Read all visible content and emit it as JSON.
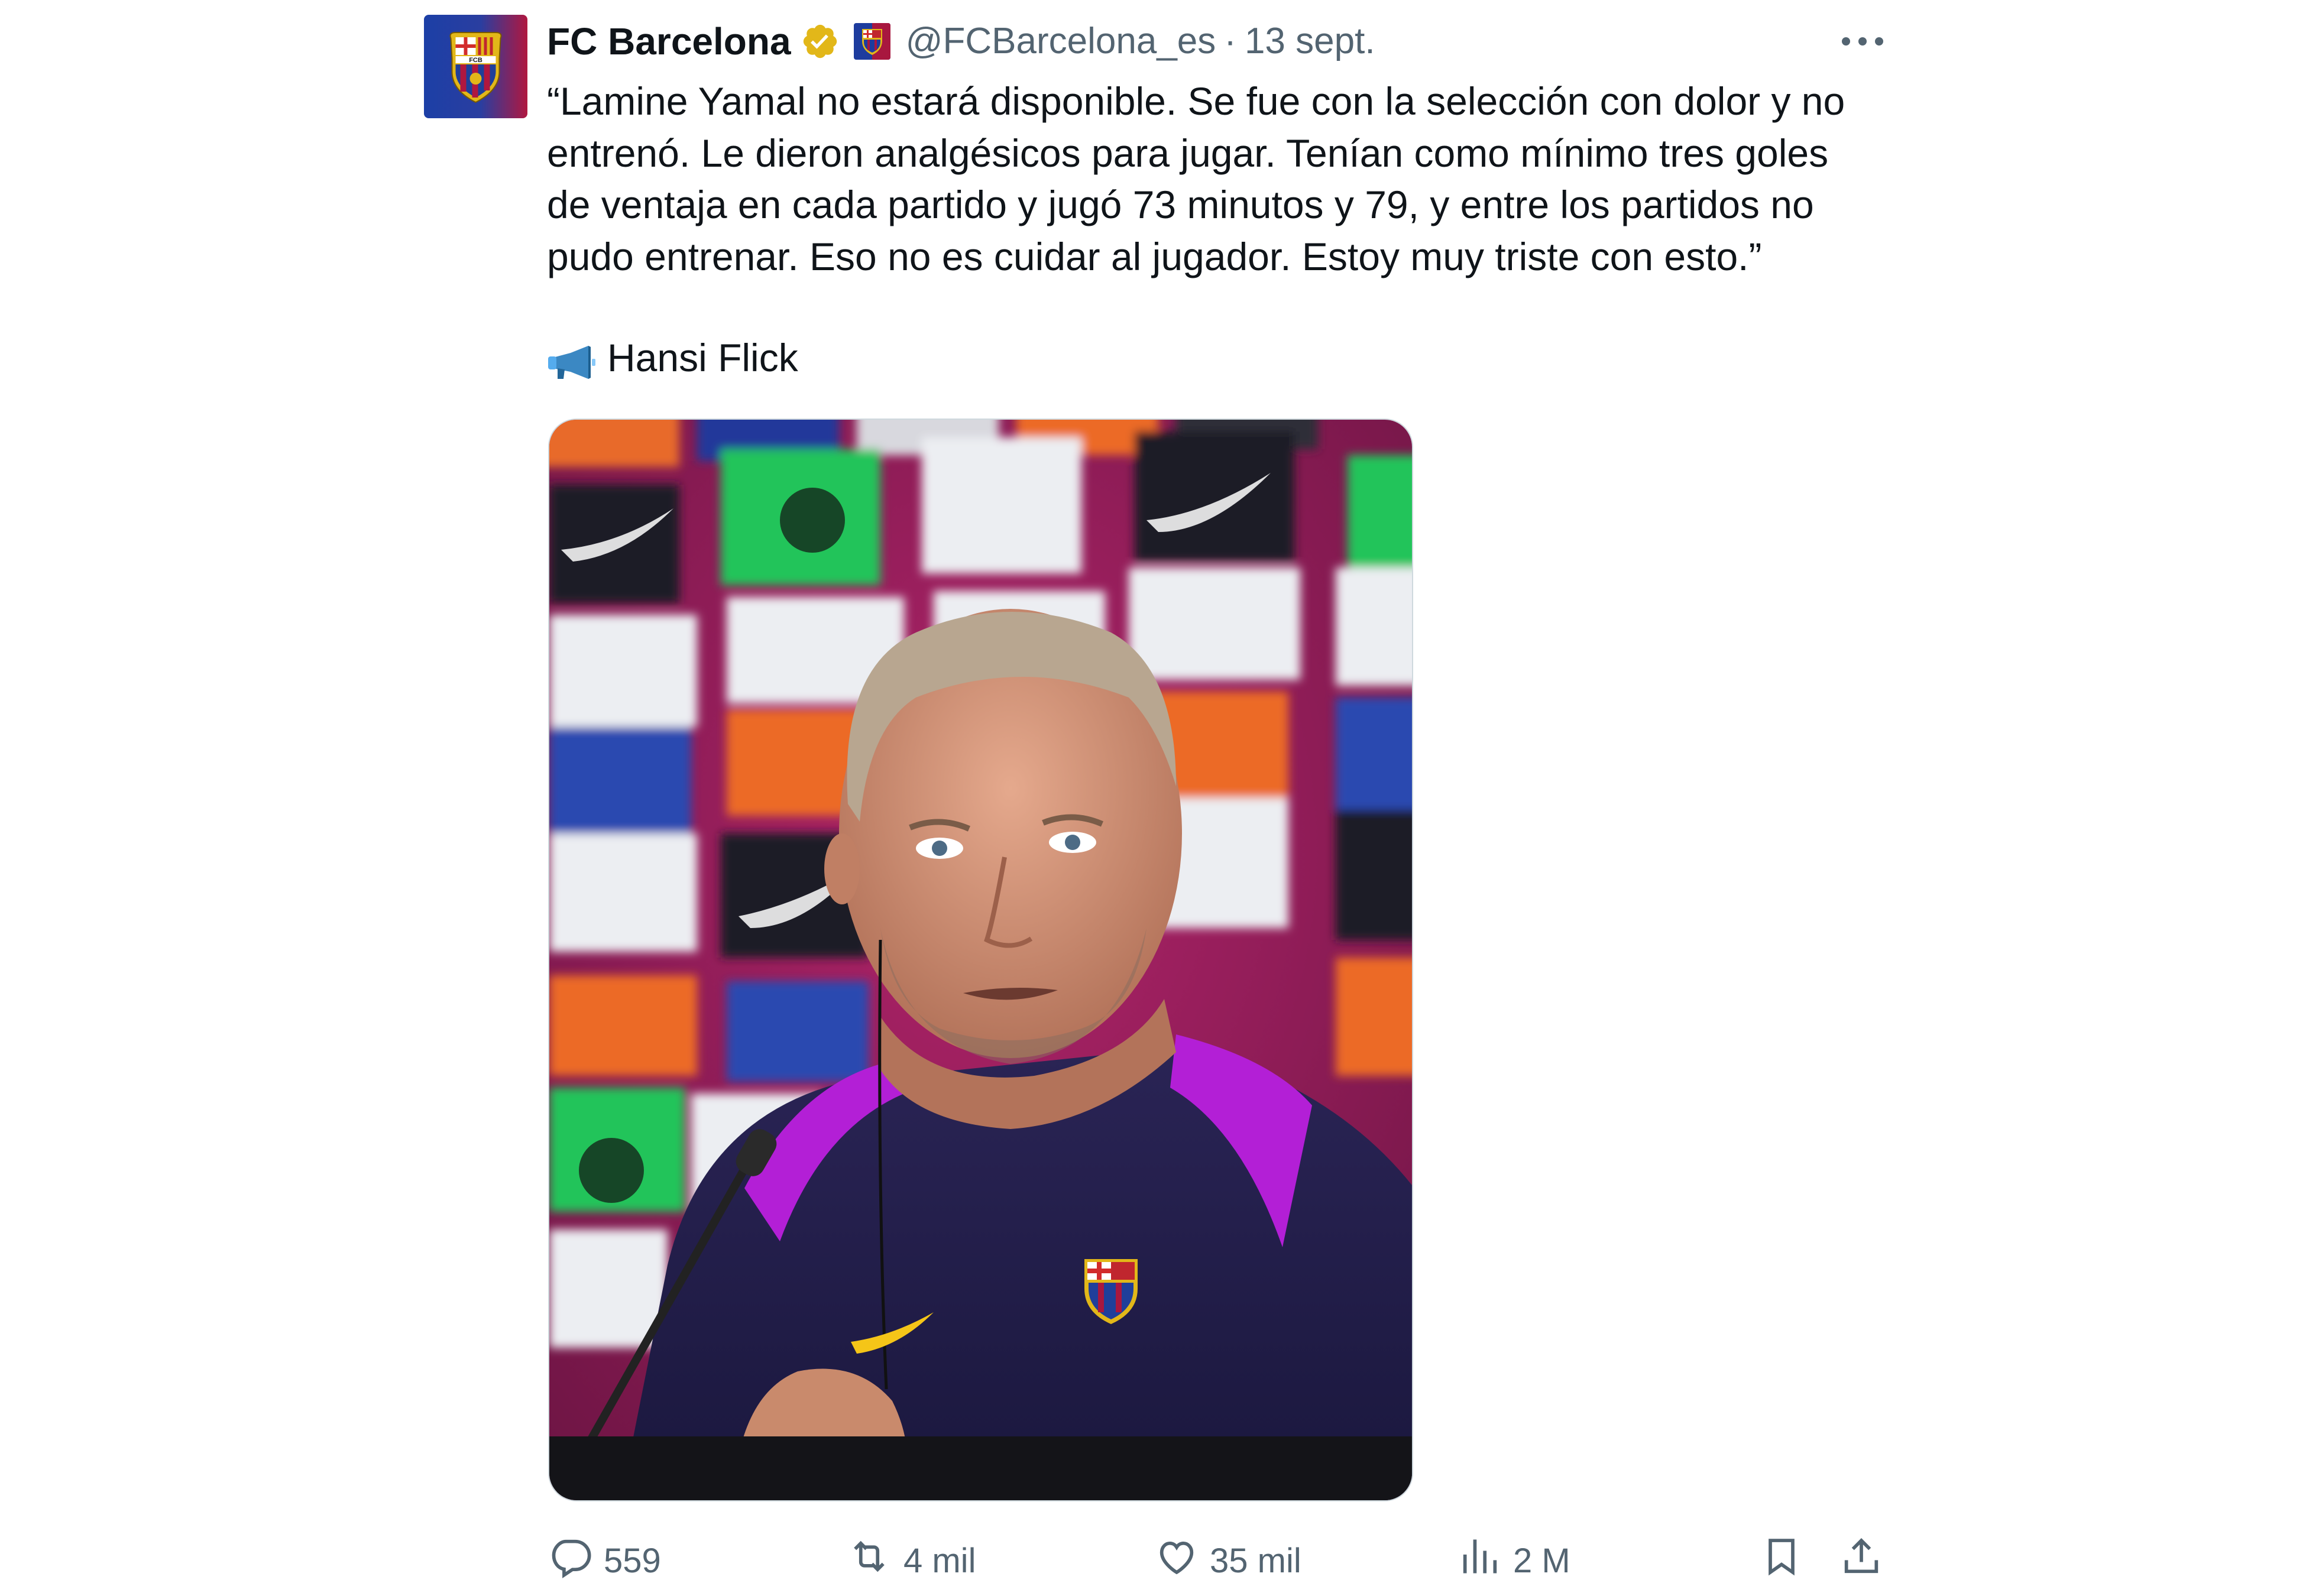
{
  "tweet": {
    "author": {
      "display_name": "FC Barcelona",
      "handle": "@FCBarcelona_es",
      "avatar_icon": "fc-barcelona-crest-icon",
      "verified_icon": "gold-verified-badge-icon",
      "affiliate_icon": "fc-barcelona-affiliate-icon"
    },
    "separator": "·",
    "timestamp": "13 sept.",
    "more_icon": "more-options-icon",
    "text_lines": [
      "“Lamine Yamal no estará disponible. Se fue con la selección con dolor y no",
      "entrenó. Le dieron analgésicos para jugar. Tenían como mínimo tres goles",
      "de ventaja en cada partido y jugó 73 minutos y 79, y entre los partidos no",
      "pudo entrenar. Eso no es cuidar al jugador. Estoy muy triste con esto.”"
    ],
    "signature": {
      "icon": "megaphone-icon",
      "text": "Hansi Flick"
    },
    "media": {
      "type": "photo",
      "subject": "press-conference-photo"
    },
    "actions": {
      "reply": {
        "icon": "reply-icon",
        "count": "559"
      },
      "retweet": {
        "icon": "retweet-icon",
        "count": "4 mil"
      },
      "like": {
        "icon": "like-icon",
        "count": "35 mil"
      },
      "views": {
        "icon": "views-icon",
        "count": "2 M"
      },
      "bookmark": {
        "icon": "bookmark-icon"
      },
      "share": {
        "icon": "share-icon"
      }
    },
    "colors": {
      "text": "#0f1419",
      "secondary": "#536471",
      "verified_gold": "#e2b719",
      "barca_blue": "#004d98",
      "barca_red": "#a50044"
    }
  }
}
